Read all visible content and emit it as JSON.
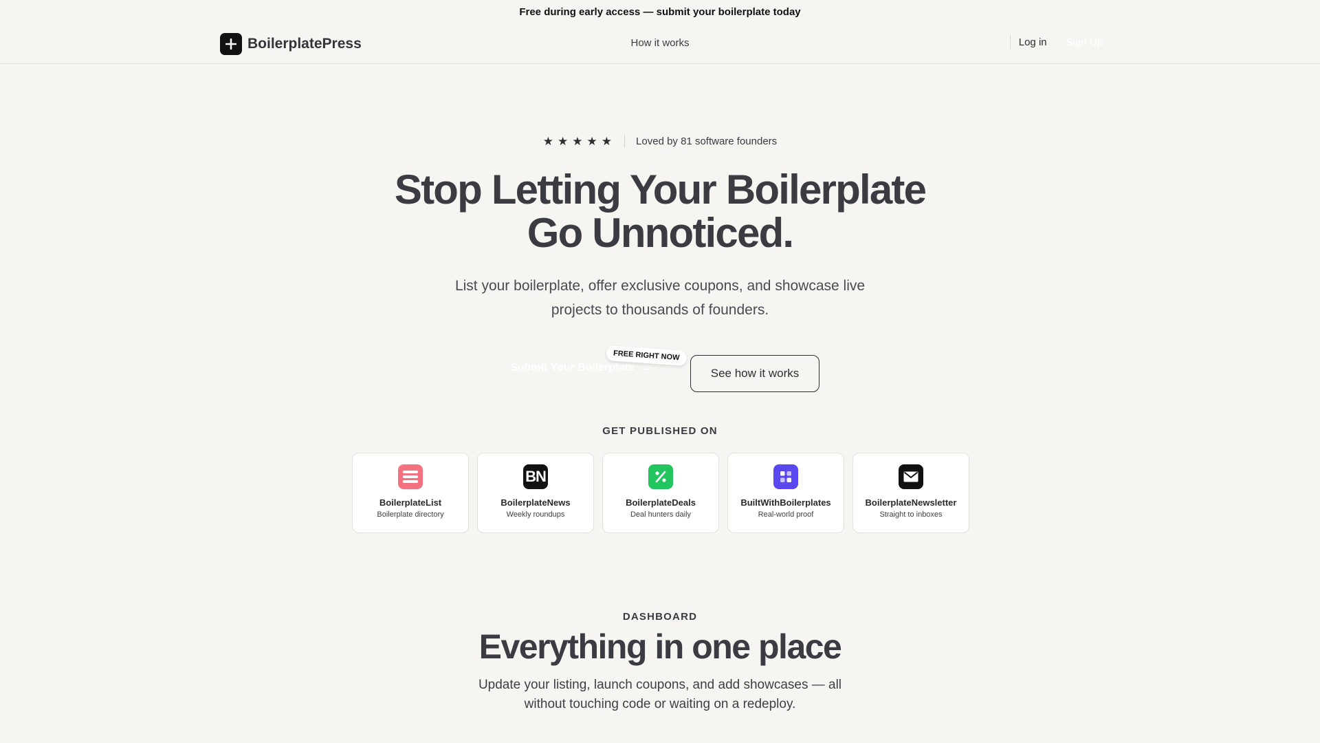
{
  "announcement": "Free during early access — submit your boilerplate today",
  "nav": {
    "brand": "BoilerplatePress",
    "center_link": "How it works",
    "login": "Log in",
    "signup": "Sign Up"
  },
  "hero": {
    "stars": 5,
    "rating_text": "Loved by 81 software founders",
    "title_line1": "Stop Letting Your Boilerplate",
    "title_line2": "Go Unnoticed.",
    "subtitle_line1": "List your boilerplate, offer exclusive coupons, and showcase live",
    "subtitle_line2": "projects to thousands of founders.",
    "primary_cta": "Submit Your Boilerplate",
    "badge": "FREE RIGHT NOW",
    "secondary_cta": "See how it works"
  },
  "published": {
    "label": "GET PUBLISHED ON",
    "platforms": [
      {
        "name": "BoilerplateList",
        "desc": "Boilerplate directory",
        "icon": "list-icon",
        "color": "#f4727f"
      },
      {
        "name": "BoilerplateNews",
        "desc": "Weekly roundups",
        "icon": "bn-logo-icon",
        "icon_text": "BN",
        "color": "#111111"
      },
      {
        "name": "BoilerplateDeals",
        "desc": "Deal hunters daily",
        "icon": "percent-icon",
        "color": "#22c55e"
      },
      {
        "name": "BuiltWithBoilerplates",
        "desc": "Real-world proof",
        "icon": "grid-icon",
        "color": "#5b47f0"
      },
      {
        "name": "BoilerplateNewsletter",
        "desc": "Straight to inboxes",
        "icon": "mail-icon",
        "color": "#111111"
      }
    ]
  },
  "dashboard": {
    "label": "DASHBOARD",
    "title": "Everything in one place",
    "subtitle_line1": "Update your listing, launch coupons, and add showcases — all",
    "subtitle_line2": "without touching code or waiting on a redeploy."
  }
}
